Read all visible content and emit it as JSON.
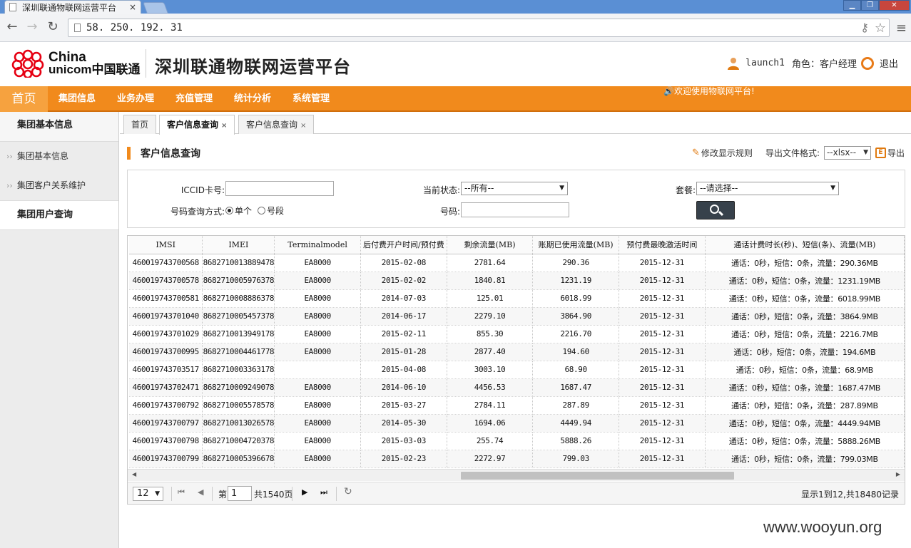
{
  "browser": {
    "tab_title": "深圳联通物联网运营平台",
    "tab_close": "×",
    "url": "58. 250. 192. 31",
    "win_min": "▁",
    "win_max": "❐",
    "win_close": "✕"
  },
  "header": {
    "logo_line1": "China",
    "logo_line2": "unicom中国联通",
    "platform_title": "深圳联通物联网运营平台",
    "username": "launch1",
    "role": "角色：客户经理",
    "logout": "退出"
  },
  "nav": {
    "home": "首页",
    "items": [
      "集团信息",
      "业务办理",
      "充值管理",
      "统计分析",
      "系统管理"
    ],
    "marquee": "欢迎使用物联网平台!"
  },
  "sidebar": {
    "header": "集团基本信息",
    "items": [
      "集团基本信息",
      "集团客户关系维护"
    ],
    "active": "集团用户查询"
  },
  "tabs": [
    {
      "label": "首页"
    },
    {
      "label": "客户信息查询",
      "close": "×"
    },
    {
      "label": "客户信息查询",
      "close": "×"
    }
  ],
  "page": {
    "title": "客户信息查询",
    "edit_rule": "修改显示规则",
    "export_format_label": "导出文件格式:",
    "export_format_value": "--xlsx--",
    "export": "导出"
  },
  "form": {
    "iccid_label": "ICCID卡号:",
    "status_label": "当前状态:",
    "status_value": "--所有--",
    "package_label": "套餐:",
    "package_value": "--请选择--",
    "query_mode_label": "号码查询方式:",
    "mode_single": "单个",
    "mode_range": "号段",
    "number_label": "号码:"
  },
  "table": {
    "columns": [
      "IMSI",
      "IMEI",
      "Terminalmodel",
      "后付费开户时间/预付费",
      "剩余流量(MB)",
      "账期已使用流量(MB)",
      "预付费最晚激活时间",
      "通话计费时长(秒)、短信(条)、流量(MB)"
    ],
    "rows": [
      [
        "460019743700568",
        "8682710013889478",
        "EA8000",
        "2015-02-08",
        "2781.64",
        "290.36",
        "2015-12-31",
        "通话：0秒，短信：0条，流量：290.36MB"
      ],
      [
        "460019743700578",
        "8682710005976378",
        "EA8000",
        "2015-02-02",
        "1840.81",
        "1231.19",
        "2015-12-31",
        "通话：0秒，短信：0条，流量：1231.19MB"
      ],
      [
        "460019743700581",
        "8682710008886378",
        "EA8000",
        "2014-07-03",
        "125.01",
        "6018.99",
        "2015-12-31",
        "通话：0秒，短信：0条，流量：6018.99MB"
      ],
      [
        "460019743701040",
        "8682710005457378",
        "EA8000",
        "2014-06-17",
        "2279.10",
        "3864.90",
        "2015-12-31",
        "通话：0秒，短信：0条，流量：3864.9MB"
      ],
      [
        "460019743701029",
        "8682710013949178",
        "EA8000",
        "2015-02-11",
        "855.30",
        "2216.70",
        "2015-12-31",
        "通话：0秒，短信：0条，流量：2216.7MB"
      ],
      [
        "460019743700995",
        "8682710004461778",
        "EA8000",
        "2015-01-28",
        "2877.40",
        "194.60",
        "2015-12-31",
        "通话：0秒，短信：0条，流量：194.6MB"
      ],
      [
        "460019743703517",
        "8682710003363178",
        "",
        "2015-04-08",
        "3003.10",
        "68.90",
        "2015-12-31",
        "通话：0秒，短信：0条，流量：68.9MB"
      ],
      [
        "460019743702471",
        "8682710009249078",
        "EA8000",
        "2014-06-10",
        "4456.53",
        "1687.47",
        "2015-12-31",
        "通话：0秒，短信：0条，流量：1687.47MB"
      ],
      [
        "460019743700792",
        "8682710005578578",
        "EA8000",
        "2015-03-27",
        "2784.11",
        "287.89",
        "2015-12-31",
        "通话：0秒，短信：0条，流量：287.89MB"
      ],
      [
        "460019743700797",
        "8682710013026578",
        "EA8000",
        "2014-05-30",
        "1694.06",
        "4449.94",
        "2015-12-31",
        "通话：0秒，短信：0条，流量：4449.94MB"
      ],
      [
        "460019743700798",
        "8682710004720378",
        "EA8000",
        "2015-03-03",
        "255.74",
        "5888.26",
        "2015-12-31",
        "通话：0秒，短信：0条，流量：5888.26MB"
      ],
      [
        "460019743700799",
        "8682710005396678",
        "EA8000",
        "2015-02-23",
        "2272.97",
        "799.03",
        "2015-12-31",
        "通话：0秒，短信：0条，流量：799.03MB"
      ]
    ]
  },
  "pager": {
    "page_size": "12",
    "page_prefix": "第",
    "page_value": "1",
    "page_total": "共1540页",
    "summary": "显示1到12,共18480记录"
  },
  "watermark": "www.wooyun.org",
  "colors": {
    "accent": "#f18a1c",
    "browser_frame": "#5a8fd4"
  }
}
